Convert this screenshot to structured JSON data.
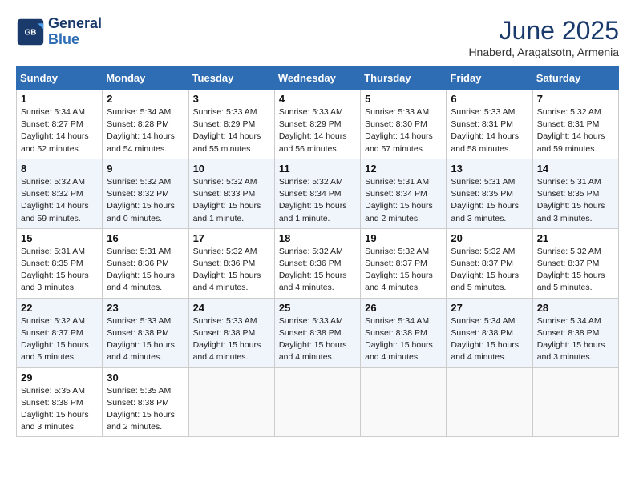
{
  "header": {
    "logo_line1": "General",
    "logo_line2": "Blue",
    "title": "June 2025",
    "subtitle": "Hnaberd, Aragatsotn, Armenia"
  },
  "weekdays": [
    "Sunday",
    "Monday",
    "Tuesday",
    "Wednesday",
    "Thursday",
    "Friday",
    "Saturday"
  ],
  "weeks": [
    [
      {
        "day": "1",
        "info": "Sunrise: 5:34 AM\nSunset: 8:27 PM\nDaylight: 14 hours\nand 52 minutes."
      },
      {
        "day": "2",
        "info": "Sunrise: 5:34 AM\nSunset: 8:28 PM\nDaylight: 14 hours\nand 54 minutes."
      },
      {
        "day": "3",
        "info": "Sunrise: 5:33 AM\nSunset: 8:29 PM\nDaylight: 14 hours\nand 55 minutes."
      },
      {
        "day": "4",
        "info": "Sunrise: 5:33 AM\nSunset: 8:29 PM\nDaylight: 14 hours\nand 56 minutes."
      },
      {
        "day": "5",
        "info": "Sunrise: 5:33 AM\nSunset: 8:30 PM\nDaylight: 14 hours\nand 57 minutes."
      },
      {
        "day": "6",
        "info": "Sunrise: 5:33 AM\nSunset: 8:31 PM\nDaylight: 14 hours\nand 58 minutes."
      },
      {
        "day": "7",
        "info": "Sunrise: 5:32 AM\nSunset: 8:31 PM\nDaylight: 14 hours\nand 59 minutes."
      }
    ],
    [
      {
        "day": "8",
        "info": "Sunrise: 5:32 AM\nSunset: 8:32 PM\nDaylight: 14 hours\nand 59 minutes."
      },
      {
        "day": "9",
        "info": "Sunrise: 5:32 AM\nSunset: 8:32 PM\nDaylight: 15 hours\nand 0 minutes."
      },
      {
        "day": "10",
        "info": "Sunrise: 5:32 AM\nSunset: 8:33 PM\nDaylight: 15 hours\nand 1 minute."
      },
      {
        "day": "11",
        "info": "Sunrise: 5:32 AM\nSunset: 8:34 PM\nDaylight: 15 hours\nand 1 minute."
      },
      {
        "day": "12",
        "info": "Sunrise: 5:31 AM\nSunset: 8:34 PM\nDaylight: 15 hours\nand 2 minutes."
      },
      {
        "day": "13",
        "info": "Sunrise: 5:31 AM\nSunset: 8:35 PM\nDaylight: 15 hours\nand 3 minutes."
      },
      {
        "day": "14",
        "info": "Sunrise: 5:31 AM\nSunset: 8:35 PM\nDaylight: 15 hours\nand 3 minutes."
      }
    ],
    [
      {
        "day": "15",
        "info": "Sunrise: 5:31 AM\nSunset: 8:35 PM\nDaylight: 15 hours\nand 3 minutes."
      },
      {
        "day": "16",
        "info": "Sunrise: 5:31 AM\nSunset: 8:36 PM\nDaylight: 15 hours\nand 4 minutes."
      },
      {
        "day": "17",
        "info": "Sunrise: 5:32 AM\nSunset: 8:36 PM\nDaylight: 15 hours\nand 4 minutes."
      },
      {
        "day": "18",
        "info": "Sunrise: 5:32 AM\nSunset: 8:36 PM\nDaylight: 15 hours\nand 4 minutes."
      },
      {
        "day": "19",
        "info": "Sunrise: 5:32 AM\nSunset: 8:37 PM\nDaylight: 15 hours\nand 4 minutes."
      },
      {
        "day": "20",
        "info": "Sunrise: 5:32 AM\nSunset: 8:37 PM\nDaylight: 15 hours\nand 5 minutes."
      },
      {
        "day": "21",
        "info": "Sunrise: 5:32 AM\nSunset: 8:37 PM\nDaylight: 15 hours\nand 5 minutes."
      }
    ],
    [
      {
        "day": "22",
        "info": "Sunrise: 5:32 AM\nSunset: 8:37 PM\nDaylight: 15 hours\nand 5 minutes."
      },
      {
        "day": "23",
        "info": "Sunrise: 5:33 AM\nSunset: 8:38 PM\nDaylight: 15 hours\nand 4 minutes."
      },
      {
        "day": "24",
        "info": "Sunrise: 5:33 AM\nSunset: 8:38 PM\nDaylight: 15 hours\nand 4 minutes."
      },
      {
        "day": "25",
        "info": "Sunrise: 5:33 AM\nSunset: 8:38 PM\nDaylight: 15 hours\nand 4 minutes."
      },
      {
        "day": "26",
        "info": "Sunrise: 5:34 AM\nSunset: 8:38 PM\nDaylight: 15 hours\nand 4 minutes."
      },
      {
        "day": "27",
        "info": "Sunrise: 5:34 AM\nSunset: 8:38 PM\nDaylight: 15 hours\nand 4 minutes."
      },
      {
        "day": "28",
        "info": "Sunrise: 5:34 AM\nSunset: 8:38 PM\nDaylight: 15 hours\nand 3 minutes."
      }
    ],
    [
      {
        "day": "29",
        "info": "Sunrise: 5:35 AM\nSunset: 8:38 PM\nDaylight: 15 hours\nand 3 minutes."
      },
      {
        "day": "30",
        "info": "Sunrise: 5:35 AM\nSunset: 8:38 PM\nDaylight: 15 hours\nand 2 minutes."
      },
      {
        "day": "",
        "info": ""
      },
      {
        "day": "",
        "info": ""
      },
      {
        "day": "",
        "info": ""
      },
      {
        "day": "",
        "info": ""
      },
      {
        "day": "",
        "info": ""
      }
    ]
  ]
}
